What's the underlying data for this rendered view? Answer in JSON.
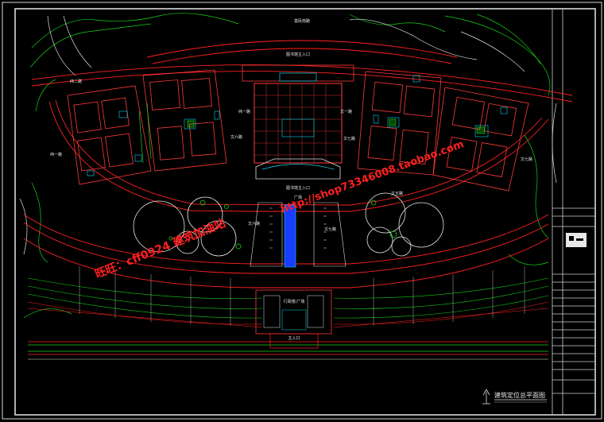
{
  "drawing": {
    "title": "建筑定位总平面图",
    "labels": {
      "top_road": "富民南路",
      "north_entrance": "图书馆主入口",
      "plaza_entrance": "图书馆主入口",
      "plaza": "广场",
      "road_west_2": "纬二路",
      "road_west_1": "纬一路",
      "road_center_1": "纬一路",
      "road_east_1": "文一路",
      "road_east_2": "文七路",
      "road_east_3": "文七路",
      "road_wen6": "文六路",
      "road_wen5": "文五路",
      "road_wen6_b": "文六路",
      "road_wen7_c": "文七路",
      "south_building": "行政楼/广场",
      "main_entrance": "主入口"
    },
    "watermarks": {
      "wangwang": "旺旺：cff0924 建筑加油站",
      "shop_url": "http://shop73346008.taobao.com"
    }
  },
  "colors": {
    "road": "#ff2020",
    "building": "#ff3a3a",
    "landscape": "#e8e8e8",
    "green_line": "#18d018",
    "cyan": "#00d8e8",
    "water": "#1a3dff",
    "border": "#e0e0e0"
  },
  "title_block": {
    "icon": "logo-icon"
  }
}
